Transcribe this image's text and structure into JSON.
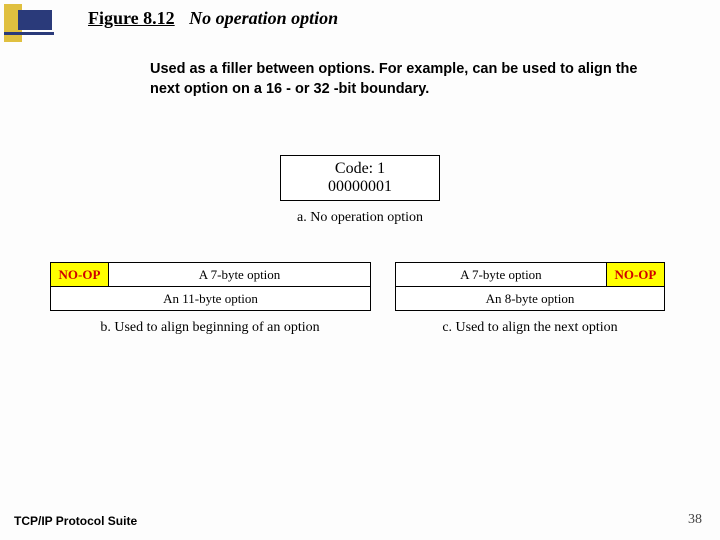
{
  "figure": {
    "label": "Figure 8.12",
    "title": "No operation option"
  },
  "description": "Used as a filler between options.  For example, can be used to align the next option on a 16 - or 32 -bit boundary.",
  "codebox": {
    "line1": "Code: 1",
    "line2": "00000001"
  },
  "captions": {
    "a": "a. No operation option",
    "b": "b. Used to align beginning of an option",
    "c": "c. Used to align the next option"
  },
  "labels": {
    "noop": "NO-OP",
    "seven_byte": "A 7-byte option",
    "eleven_byte": "An 11-byte option",
    "eight_byte": "An 8-byte option"
  },
  "footer": {
    "book": "TCP/IP Protocol Suite",
    "page": "38"
  }
}
